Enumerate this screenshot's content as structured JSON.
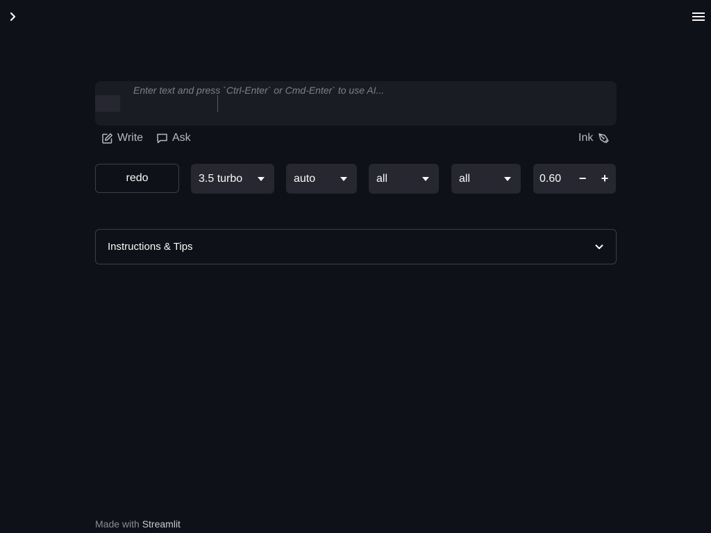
{
  "editor": {
    "placeholder": "Enter text and press `Ctrl-Enter` or Cmd-Enter` to use AI..."
  },
  "actions": {
    "write_label": "Write",
    "ask_label": "Ask",
    "ink_label": "Ink"
  },
  "controls": {
    "redo_label": "redo",
    "model_select": "3.5 turbo",
    "mode_select": "auto",
    "scope_select_1": "all",
    "scope_select_2": "all",
    "temperature": "0.60",
    "minus_label": "−",
    "plus_label": "+"
  },
  "expander": {
    "label": "Instructions & Tips"
  },
  "footer": {
    "prefix": "Made with ",
    "brand": "Streamlit"
  },
  "icons": {
    "sidebar_toggle": "chevron-right-icon",
    "menu": "hamburger-icon",
    "write": "edit-icon",
    "ask": "chat-bubble-icon",
    "ink": "pen-icon",
    "expand": "chevron-down-icon"
  },
  "colors": {
    "background": "#0e1117",
    "surface": "#262730",
    "editor": "#1a1c24",
    "border": "#3d4049",
    "text": "#fafafa",
    "muted": "#b8bac2"
  }
}
